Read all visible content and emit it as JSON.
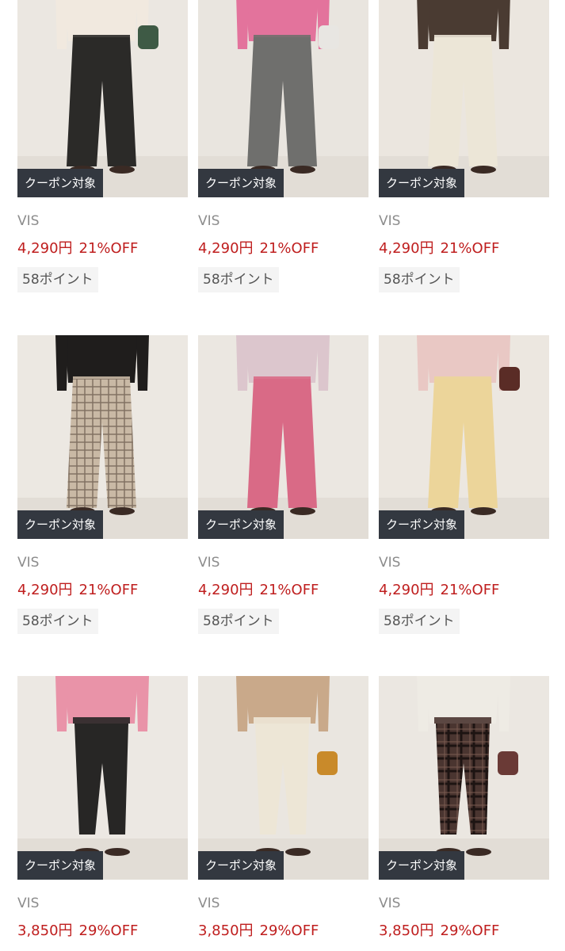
{
  "products": [
    {
      "brand": "VIS",
      "price": "4,290円",
      "discount": "21%OFF",
      "points": "58ポイント",
      "badge": "クーポン対象",
      "pants_color": "#2b2a28",
      "top_color": "#f1e9df",
      "bg_color": "#ebe7e1",
      "pattern": "solid",
      "bag": "#3e5a45",
      "fit": "wide"
    },
    {
      "brand": "VIS",
      "price": "4,290円",
      "discount": "21%OFF",
      "points": "58ポイント",
      "badge": "クーポン対象",
      "pants_color": "#6f6f6d",
      "top_color": "#e3739c",
      "bg_color": "#e9e5df",
      "pattern": "solid",
      "bag": "#e8e6e2",
      "fit": "wide"
    },
    {
      "brand": "VIS",
      "price": "4,290円",
      "discount": "21%OFF",
      "points": "58ポイント",
      "badge": "クーポン対象",
      "pants_color": "#ece6d7",
      "top_color": "#4a3b32",
      "bg_color": "#ebe6df",
      "pattern": "solid",
      "bag": "",
      "fit": "wide"
    },
    {
      "brand": "VIS",
      "price": "4,290円",
      "discount": "21%OFF",
      "points": "58ポイント",
      "badge": "クーポン対象",
      "pants_color": "#c9b9a5",
      "top_color": "#1f1d1c",
      "bg_color": "#ece8e2",
      "pattern": "check",
      "bag": "",
      "fit": "wide"
    },
    {
      "brand": "VIS",
      "price": "4,290円",
      "discount": "21%OFF",
      "points": "58ポイント",
      "badge": "クーポン対象",
      "pants_color": "#d96a86",
      "top_color": "#dcc6cd",
      "bg_color": "#ebe7e1",
      "pattern": "solid",
      "bag": "",
      "fit": "wide"
    },
    {
      "brand": "VIS",
      "price": "4,290円",
      "discount": "21%OFF",
      "points": "58ポイント",
      "badge": "クーポン対象",
      "pants_color": "#ecd59a",
      "top_color": "#e9c8c4",
      "bg_color": "#ece7e0",
      "pattern": "solid",
      "bag": "#5a2c26",
      "fit": "wide"
    },
    {
      "brand": "VIS",
      "price": "3,850円",
      "discount": "29%OFF",
      "points": "",
      "badge": "クーポン対象",
      "pants_color": "#272625",
      "top_color": "#e993a8",
      "bg_color": "#ece8e3",
      "pattern": "solid",
      "bag": "",
      "fit": "tapered"
    },
    {
      "brand": "VIS",
      "price": "3,850円",
      "discount": "29%OFF",
      "points": "",
      "badge": "クーポン対象",
      "pants_color": "#ede6d6",
      "top_color": "#c9a98a",
      "bg_color": "#eae6e0",
      "pattern": "solid",
      "bag": "#c98a2a",
      "fit": "tapered"
    },
    {
      "brand": "VIS",
      "price": "3,850円",
      "discount": "29%OFF",
      "points": "",
      "badge": "クーポン対象",
      "pants_color": "#4a3530",
      "top_color": "#eeebe4",
      "bg_color": "#ebe7e1",
      "pattern": "check-dark",
      "bag": "#6a3a36",
      "fit": "tapered"
    }
  ]
}
